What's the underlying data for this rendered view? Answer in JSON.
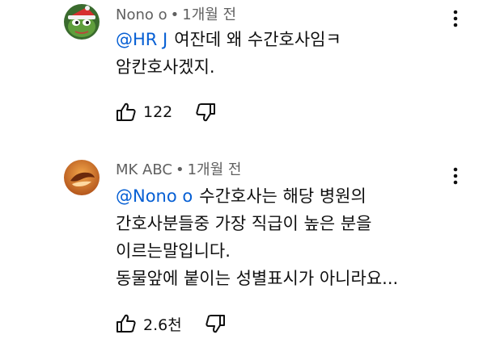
{
  "comments": [
    {
      "author": "Nono o",
      "separator": "•",
      "time": "1개월 전",
      "mention": "@HR J",
      "text_line1": "여잔데 왜 수간호사임ㅋ",
      "text_line2": "암칸호사겠지.",
      "likes": "122",
      "avatar_icon": "frog-santa-avatar-icon"
    },
    {
      "author": "MK ABC",
      "separator": "•",
      "time": "1개월 전",
      "mention": "@Nono o",
      "text_line1": "수간호사는 해당 병원의",
      "text_line2": "간호사분들중 가장 직급이 높은 분을",
      "text_line3": "이르는말입니다.",
      "text_line4": "동물앞에 붙이는 성별표시가 아니라요...",
      "likes": "2.6천",
      "avatar_icon": "orange-logo-avatar-icon"
    }
  ],
  "colors": {
    "mention": "#065fd4",
    "meta": "#606060",
    "text": "#0f0f0f"
  }
}
